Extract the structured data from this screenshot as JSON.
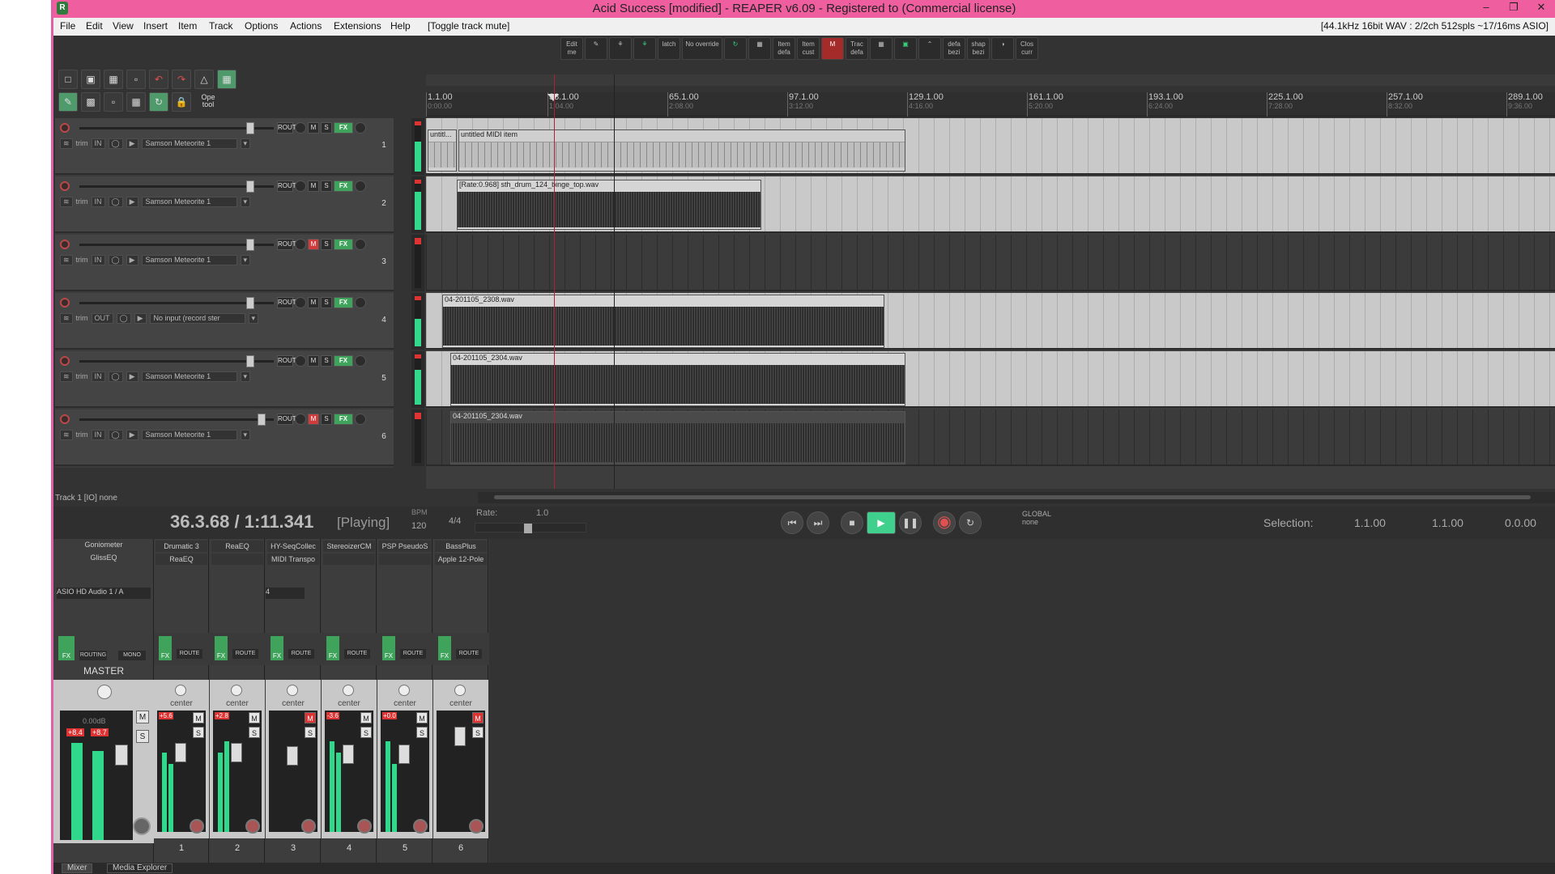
{
  "window": {
    "title": "Acid Success [modified] - REAPER v6.09 - Registered to      (Commercial license)",
    "controls": [
      "–",
      "❐",
      "✕"
    ]
  },
  "menu": {
    "items": [
      "File",
      "Edit",
      "View",
      "Insert",
      "Item",
      "Track",
      "Options",
      "Actions",
      "Extensions",
      "Help",
      "[Toggle track mute]"
    ],
    "status": "[44.1kHz 16bit WAV : 2/2ch 512spls ~17/16ms ASIO]"
  },
  "top_toolbar": [
    {
      "label": "Edit\nme"
    },
    {
      "label": "✎"
    },
    {
      "label": "⚘"
    },
    {
      "label": "⚘"
    },
    {
      "label": "latch"
    },
    {
      "label": "No\noverride"
    },
    {
      "label": "↻"
    },
    {
      "label": "▦"
    },
    {
      "label": "Item\ndefa"
    },
    {
      "label": "Item\ncust"
    },
    {
      "label": "M"
    },
    {
      "label": "Trac\ndefa"
    },
    {
      "label": "▦"
    },
    {
      "label": "▣"
    },
    {
      "label": "⌃"
    },
    {
      "label": "defa\nbezi"
    },
    {
      "label": "shap\nbezi"
    },
    {
      "label": "◑"
    },
    {
      "label": "Clos\ncurr"
    }
  ],
  "left_toolbar": {
    "ope_tool": "Ope\ntool"
  },
  "ruler": {
    "marks": [
      {
        "bar": "1.1.00",
        "time": "0:00.00"
      },
      {
        "bar": "33.1.00",
        "time": "1:04.00"
      },
      {
        "bar": "65.1.00",
        "time": "2:08.00"
      },
      {
        "bar": "97.1.00",
        "time": "3:12.00"
      },
      {
        "bar": "129.1.00",
        "time": "4:16.00"
      },
      {
        "bar": "161.1.00",
        "time": "5:20.00"
      },
      {
        "bar": "193.1.00",
        "time": "6:24.00"
      },
      {
        "bar": "225.1.00",
        "time": "7:28.00"
      },
      {
        "bar": "257.1.00",
        "time": "8:32.00"
      },
      {
        "bar": "289.1.00",
        "time": "9:36.00"
      }
    ]
  },
  "tracks": [
    {
      "num": "1",
      "io": "trim",
      "in": "IN",
      "input": "Samson Meteorite 1",
      "muted": false
    },
    {
      "num": "2",
      "io": "trim",
      "in": "IN",
      "input": "Samson Meteorite 1",
      "muted": false
    },
    {
      "num": "3",
      "io": "trim",
      "in": "IN",
      "input": "Samson Meteorite 1",
      "muted": true
    },
    {
      "num": "4",
      "io": "trim",
      "in": "OUT",
      "input": "No input (record ster",
      "muted": false
    },
    {
      "num": "5",
      "io": "trim",
      "in": "IN",
      "input": "Samson Meteorite 1",
      "muted": false
    },
    {
      "num": "6",
      "io": "trim",
      "in": "IN",
      "input": "Samson Meteorite 1",
      "muted": true
    }
  ],
  "track_buttons": {
    "route": "ROUT",
    "m": "M",
    "s": "S",
    "fx": "FX"
  },
  "items": {
    "midi_a": "untitl...",
    "midi_b": "untitled MIDI item",
    "drum": "[Rate:0.968] sth_drum_124_binge_top.wav",
    "t4": "04-201105_2308.wav",
    "t5": "04-201105_2304.wav",
    "t6": "04-201105_2304.wav"
  },
  "tcp_footer": "Track 1 [IO] none",
  "transport": {
    "time": "36.3.68 / 1:11.341",
    "state": "[Playing]",
    "bpm_label": "BPM",
    "bpm": "120",
    "signature": "4/4",
    "rate_label": "Rate:",
    "rate": "1.0",
    "global": "GLOBAL",
    "global_mode": "none",
    "selection_label": "Selection:",
    "sel_start": "1.1.00",
    "sel_end": "1.1.00",
    "sel_len": "0.0.00"
  },
  "mixer": {
    "master": {
      "label": "MASTER",
      "fx1": "Goniometer",
      "fx2": "GlissEQ",
      "input": "ASIO HD Audio 1 / A",
      "db": "0.00dB",
      "peak_l": "+8.4",
      "peak_r": "+8.7",
      "routing": "ROUTING",
      "mono": "MONO",
      "fx": "FX"
    },
    "strips": [
      {
        "num": "1",
        "fx1": "Drumatic 3",
        "fx2": "ReaEQ",
        "pan": "center",
        "peak": "+5.6",
        "route": "ROUTE",
        "fx": "FX"
      },
      {
        "num": "2",
        "fx1": "ReaEQ",
        "fx2": "",
        "pan": "center",
        "peak": "+2.8",
        "route": "ROUTE",
        "fx": "FX"
      },
      {
        "num": "3",
        "fx1": "HY-SeqCollec",
        "fx2": "MIDI Transpo",
        "pan": "center",
        "peak": "",
        "route": "ROUTE",
        "fx": "FX"
      },
      {
        "num": "4",
        "fx1": "StereoizerCM",
        "fx2": "",
        "pan": "center",
        "peak": "-3.6",
        "route": "ROUTE",
        "fx": "FX"
      },
      {
        "num": "5",
        "fx1": "PSP PseudoS",
        "fx2": "",
        "pan": "center",
        "peak": "+0.0",
        "route": "ROUTE",
        "fx": "FX"
      },
      {
        "num": "6",
        "fx1": "BassPlus",
        "fx2": "Apple 12-Pole",
        "pan": "center",
        "peak": "",
        "route": "ROUTE",
        "fx": "FX"
      }
    ],
    "strip3_input": "4"
  },
  "bottom_tabs": [
    "Mixer",
    "Media Explorer"
  ],
  "colors": {
    "titlebar": "#ef5fa0",
    "meter": "#33d88c",
    "mute": "#d23b3b",
    "fx": "#3fa35c"
  }
}
